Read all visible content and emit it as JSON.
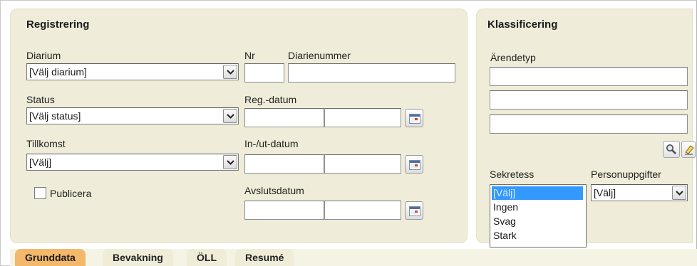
{
  "registrering": {
    "title": "Registrering",
    "diarium_label": "Diarium",
    "diarium_value": "[Välj diarium]",
    "nr_label": "Nr",
    "diarienummer_label": "Diarienummer",
    "status_label": "Status",
    "status_value": "[Välj status]",
    "regdatum_label": "Reg.-datum",
    "tillkomst_label": "Tillkomst",
    "tillkomst_value": "[Välj]",
    "inutdatum_label": "In-/ut-datum",
    "publicera_label": "Publicera",
    "publicera_checked": false,
    "avslutsdatum_label": "Avslutsdatum"
  },
  "klassificering": {
    "title": "Klassificering",
    "arendetyp_label": "Ärendetyp",
    "sekretess_label": "Sekretess",
    "sekretess_options": [
      "[Välj]",
      "Ingen",
      "Svag",
      "Stark"
    ],
    "sekretess_selected": "[Välj]",
    "personuppgifter_label": "Personuppgifter",
    "personuppgifter_value": "[Välj]"
  },
  "tabs": [
    "Grunddata",
    "Bevakning",
    "ÖLL",
    "Resumé"
  ],
  "active_tab": "Grunddata",
  "icons": {
    "dropdown": "chevron-down-icon",
    "calendar": "calendar-icon",
    "search": "magnifier-icon",
    "clear": "eraser-icon"
  },
  "colors": {
    "panel_bg": "#efedd9",
    "active_tab": "#f4b86a",
    "selected_option": "#3399ff"
  }
}
